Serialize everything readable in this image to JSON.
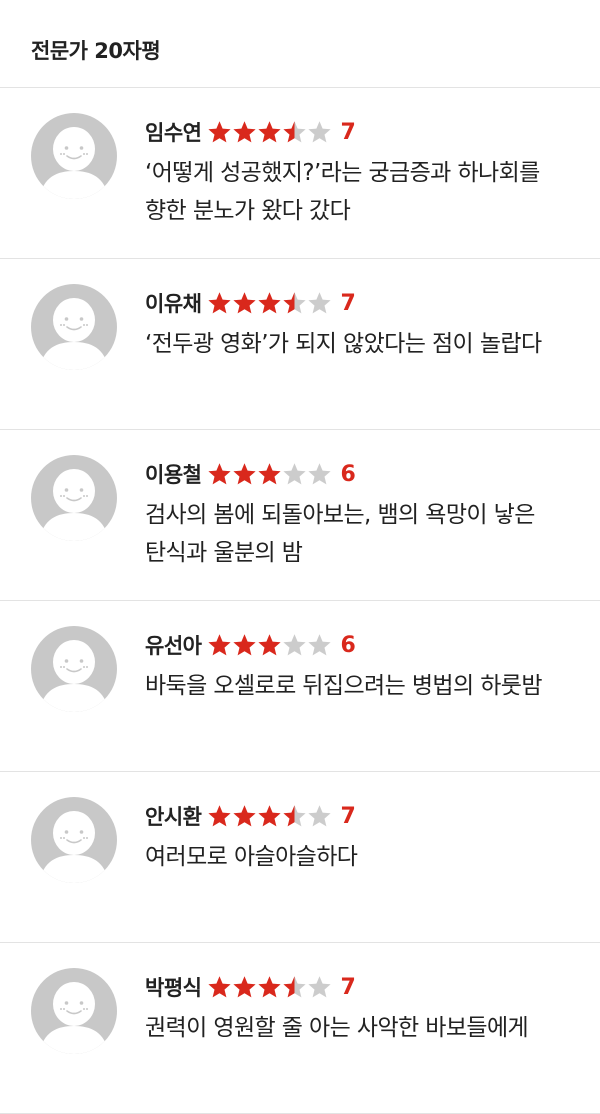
{
  "header": {
    "title": "전문가 20자평"
  },
  "colors": {
    "star_filled": "#d9281c",
    "star_empty": "#cccccc",
    "score": "#d9281c",
    "avatar": "#c8c8c8",
    "divider": "#e3e3e3"
  },
  "reviews": [
    {
      "name": "임수연",
      "rating_out_of_10": 7,
      "score": "7",
      "comment": "‘어떻게 성공했지?’라는 궁금증과 하나회를 향한 분노가 왔다 갔다"
    },
    {
      "name": "이유채",
      "rating_out_of_10": 7,
      "score": "7",
      "comment": "‘전두광 영화’가 되지 않았다는 점이 놀랍다"
    },
    {
      "name": "이용철",
      "rating_out_of_10": 6,
      "score": "6",
      "comment": "검사의 봄에 되돌아보는, 뱀의 욕망이 낳은 탄식과 울분의 밤"
    },
    {
      "name": "유선아",
      "rating_out_of_10": 6,
      "score": "6",
      "comment": "바둑을 오셀로로 뒤집으려는 병법의 하룻밤"
    },
    {
      "name": "안시환",
      "rating_out_of_10": 7,
      "score": "7",
      "comment": "여러모로 아슬아슬하다"
    },
    {
      "name": "박평식",
      "rating_out_of_10": 7,
      "score": "7",
      "comment": "권력이 영원할 줄 아는 사악한 바보들에게"
    }
  ]
}
